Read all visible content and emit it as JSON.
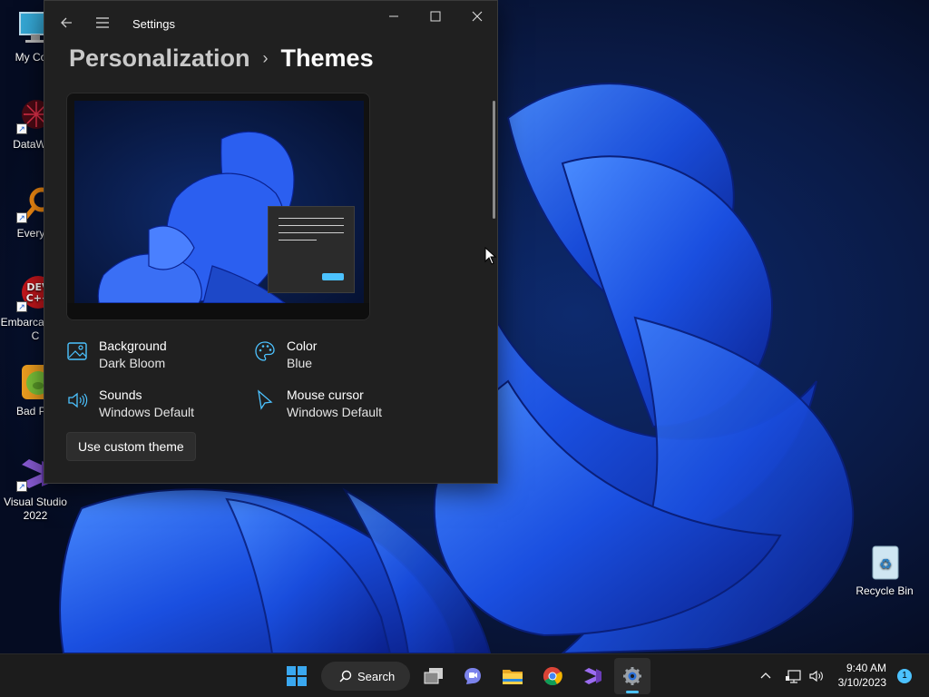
{
  "desktop": {
    "icons": [
      {
        "label": "My Com",
        "icon": "computer-icon"
      },
      {
        "label": "DataWag",
        "icon": "datawag-icon"
      },
      {
        "label": "Everyth",
        "icon": "everything-search-icon"
      },
      {
        "label": "Embarca Dev-C",
        "icon": "embarcadero-devcpp-icon"
      },
      {
        "label": "Bad Pig",
        "icon": "bad-piggies-icon"
      },
      {
        "label": "Visual Studio 2022",
        "icon": "visual-studio-icon"
      }
    ],
    "recycle_bin": {
      "label": "Recycle Bin",
      "icon": "recycle-bin-icon"
    }
  },
  "settings": {
    "window_title": "Settings",
    "breadcrumb": {
      "parent": "Personalization",
      "separator": "›",
      "current": "Themes"
    },
    "theme": {
      "background": {
        "label": "Background",
        "value": "Dark Bloom"
      },
      "color": {
        "label": "Color",
        "value": "Blue"
      },
      "sounds": {
        "label": "Sounds",
        "value": "Windows Default"
      },
      "cursor": {
        "label": "Mouse cursor",
        "value": "Windows Default"
      }
    },
    "custom_theme_button": "Use custom theme"
  },
  "taskbar": {
    "search_label": "Search",
    "apps": [
      "start-icon",
      "task-view-icon",
      "chat-icon",
      "file-explorer-icon",
      "chrome-icon",
      "visual-studio-icon",
      "settings-icon"
    ],
    "clock": {
      "time": "9:40 AM",
      "date": "3/10/2023"
    },
    "notification_count": "1"
  },
  "colors": {
    "accent": "#4cc2ff",
    "window_bg": "#202020",
    "taskbar_bg": "#1c1c1c"
  }
}
